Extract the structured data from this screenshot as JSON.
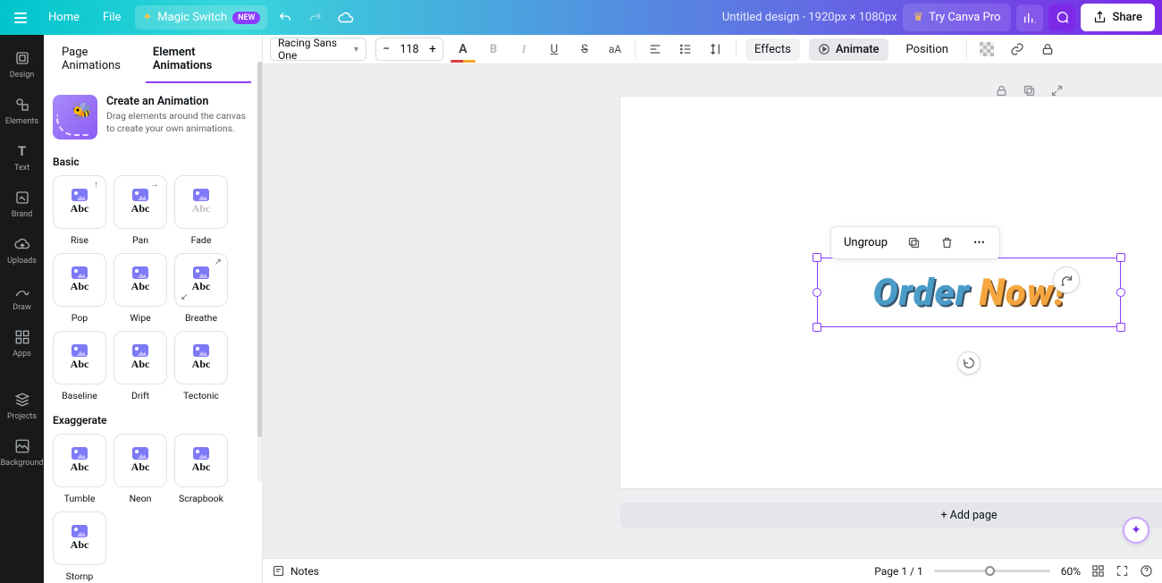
{
  "header": {
    "home": "Home",
    "file": "File",
    "magic": "Magic Switch",
    "new_badge": "NEW",
    "title": "Untitled design - 1920px × 1080px",
    "try_pro": "Try Canva Pro",
    "share": "Share"
  },
  "rail": [
    {
      "key": "design",
      "label": "Design"
    },
    {
      "key": "elements",
      "label": "Elements"
    },
    {
      "key": "text",
      "label": "Text"
    },
    {
      "key": "brand",
      "label": "Brand"
    },
    {
      "key": "uploads",
      "label": "Uploads"
    },
    {
      "key": "draw",
      "label": "Draw"
    },
    {
      "key": "apps",
      "label": "Apps"
    },
    {
      "key": "projects",
      "label": "Projects"
    },
    {
      "key": "background",
      "label": "Background"
    }
  ],
  "panel": {
    "tabs": {
      "page": "Page Animations",
      "element": "Element Animations"
    },
    "create": {
      "title": "Create an Animation",
      "desc": "Drag elements around the canvas to create your own animations."
    },
    "sections": {
      "basic": {
        "label": "Basic",
        "items": [
          "Rise",
          "Pan",
          "Fade",
          "Pop",
          "Wipe",
          "Breathe",
          "Baseline",
          "Drift",
          "Tectonic"
        ]
      },
      "exaggerate": {
        "label": "Exaggerate",
        "items": [
          "Tumble",
          "Neon",
          "Scrapbook",
          "Stomp"
        ]
      }
    }
  },
  "toolbar": {
    "font": "Racing Sans One",
    "size": "118",
    "effects": "Effects",
    "animate": "Animate",
    "position": "Position"
  },
  "context_menu": {
    "ungroup": "Ungroup"
  },
  "canvas_text": {
    "w1": "Order",
    "w2": "Now!"
  },
  "add_page": "+ Add page",
  "footer": {
    "notes": "Notes",
    "page_label": "Page 1 / 1",
    "zoom": "60%"
  }
}
